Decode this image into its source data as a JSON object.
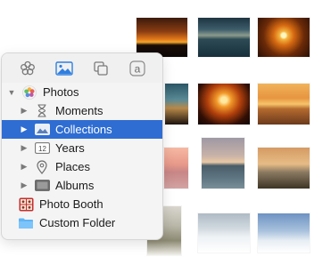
{
  "toolbar": {
    "tools": [
      {
        "name": "flower-icon"
      },
      {
        "name": "photos-icon"
      },
      {
        "name": "copy-icon"
      },
      {
        "name": "font-icon"
      }
    ]
  },
  "sidebar": {
    "items": [
      {
        "label": "Photos",
        "icon": "photos-app-icon",
        "level": 0,
        "expanded": true
      },
      {
        "label": "Moments",
        "icon": "hourglass-icon",
        "level": 1
      },
      {
        "label": "Collections",
        "icon": "collections-icon",
        "level": 1,
        "selected": true
      },
      {
        "label": "Years",
        "icon": "calendar-icon",
        "level": 1
      },
      {
        "label": "Places",
        "icon": "pin-icon",
        "level": 1
      },
      {
        "label": "Albums",
        "icon": "album-icon",
        "level": 1
      },
      {
        "label": "Photo Booth",
        "icon": "photo-booth-icon",
        "level": 0
      },
      {
        "label": "Custom Folder",
        "icon": "folder-icon",
        "level": 0
      }
    ],
    "selected_color": "#2f6dd2"
  },
  "years_icon_text": "12"
}
